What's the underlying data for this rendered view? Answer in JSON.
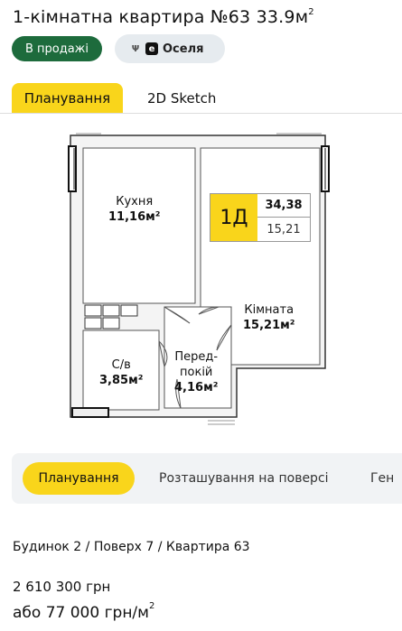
{
  "header": {
    "title": "1-кімнатна квартира №63 33.9м",
    "title_sup": "2",
    "status_badge": "В продажі",
    "program_badge": "Оселя",
    "program_icon": "е"
  },
  "top_tabs": [
    {
      "label": "Планування",
      "active": true
    },
    {
      "label": "2D Sketch",
      "active": false
    }
  ],
  "floorplan": {
    "rooms": [
      {
        "name": "Кухня",
        "area": "11,16м²"
      },
      {
        "name": "Кімната",
        "area": "15,21м²"
      },
      {
        "name": "С/в",
        "area": "3,85м²"
      },
      {
        "name": "Перед-",
        "name2": "покій",
        "area": "4,16м²"
      }
    ],
    "apartment_code": "1Д",
    "total_area": "34,38",
    "room_area": "15,21"
  },
  "bottom_tabs": [
    {
      "label": "Планування",
      "active": true
    },
    {
      "label": "Розташування на поверсі",
      "active": false
    },
    {
      "label": "Ген",
      "active": false
    }
  ],
  "info": {
    "breadcrumb": "Будинок 2 / Поверх 7 / Квартира 63",
    "price": "2 610 300 грн",
    "price_per_m2": "або 77 000 грн/м",
    "price_per_m2_sup": "2"
  },
  "colors": {
    "accent": "#f9d51b",
    "sale_badge": "#1d6b3c",
    "badge_bg": "#e6ebef",
    "tabs_bg": "#f1f3f5"
  }
}
